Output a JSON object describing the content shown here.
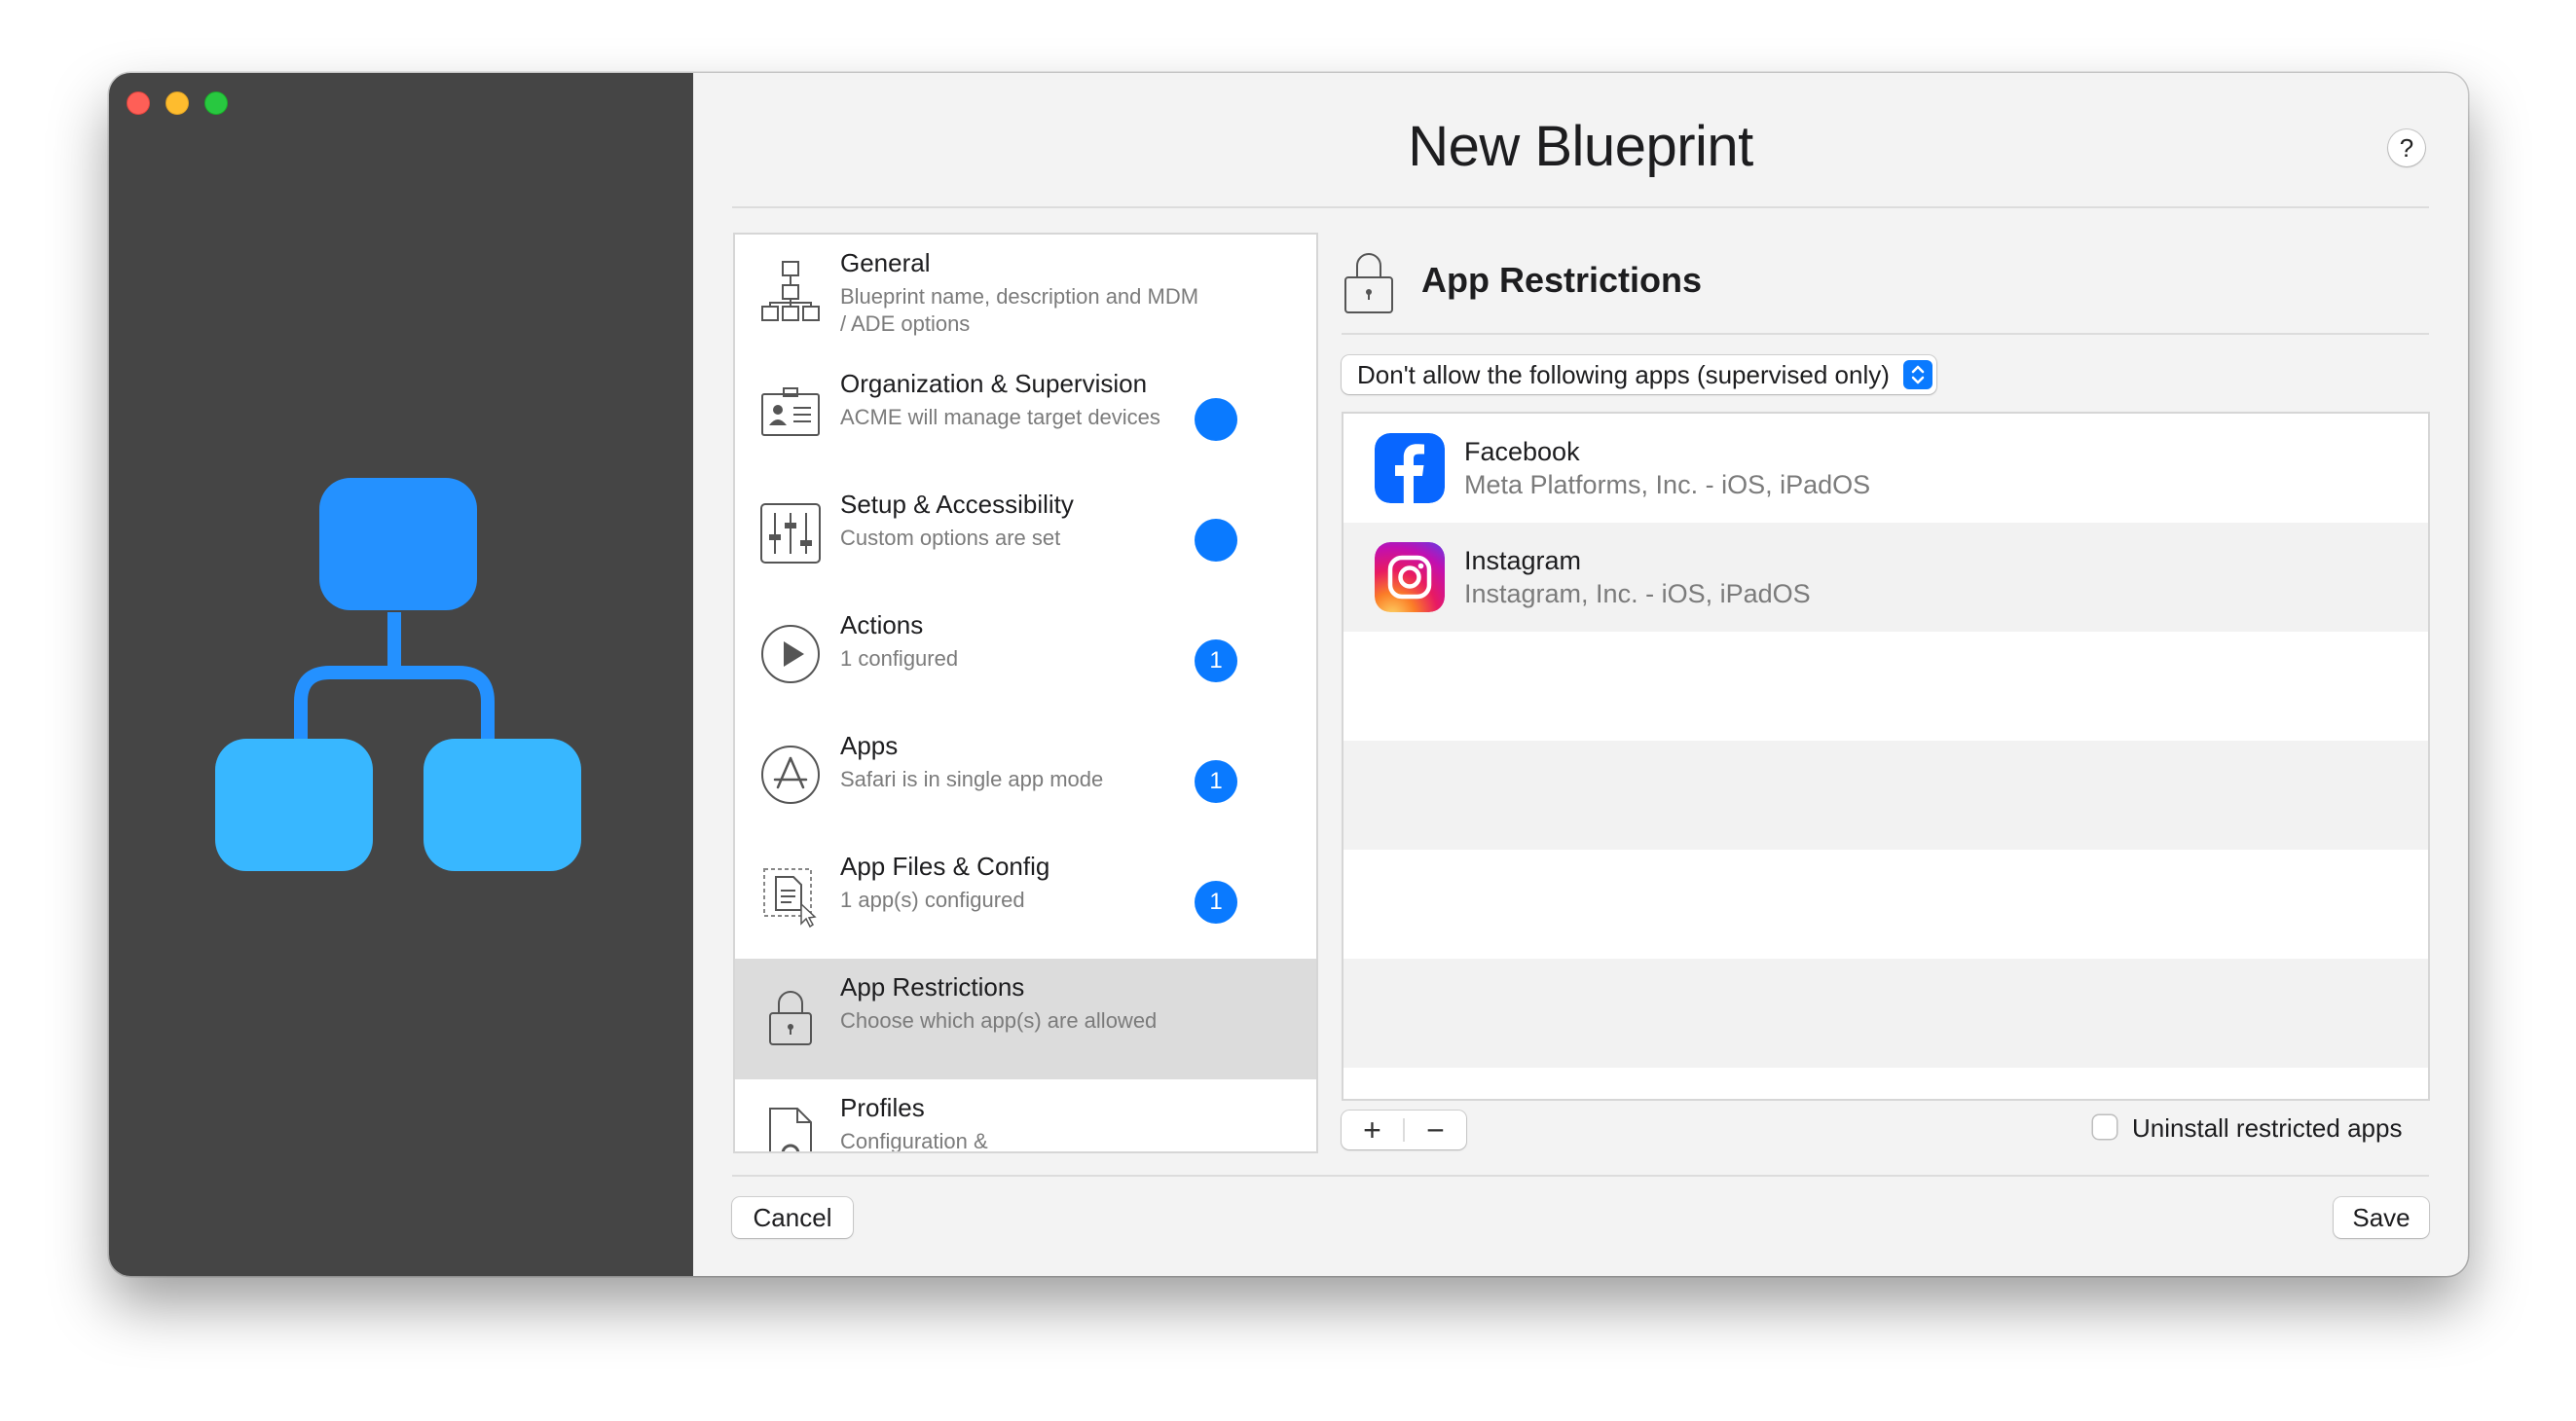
{
  "window": {
    "title": "New Blueprint",
    "help_label": "?"
  },
  "illustration": {
    "icon": "blueprint-hierarchy-icon",
    "colors": [
      "#2491ff",
      "#38b7ff"
    ]
  },
  "sections": [
    {
      "title": "General",
      "subtitle": "Blueprint name, description and MDM / ADE options",
      "icon": "hierarchy-icon",
      "badge": null,
      "selected": false
    },
    {
      "title": "Organization & Supervision",
      "subtitle": "ACME will manage target devices",
      "icon": "id-card-icon",
      "badge": "",
      "selected": false
    },
    {
      "title": "Setup & Accessibility",
      "subtitle": "Custom options are set",
      "icon": "sliders-icon",
      "badge": "",
      "selected": false
    },
    {
      "title": "Actions",
      "subtitle": "1 configured",
      "icon": "play-icon",
      "badge": "1",
      "selected": false
    },
    {
      "title": "Apps",
      "subtitle": "Safari is in single app mode",
      "icon": "app-store-icon",
      "badge": "1",
      "selected": false
    },
    {
      "title": "App Files & Config",
      "subtitle": "1 app(s) configured",
      "icon": "file-config-icon",
      "badge": "1",
      "selected": false
    },
    {
      "title": "App Restrictions",
      "subtitle": "Choose which app(s) are allowed",
      "icon": "lock-icon",
      "badge": null,
      "selected": true
    },
    {
      "title": "Profiles",
      "subtitle": "Configuration &",
      "icon": "profile-gear-icon",
      "badge": null,
      "selected": false
    }
  ],
  "detail": {
    "title": "App Restrictions",
    "mode_selected": "Don't allow the following apps (supervised only)",
    "apps": [
      {
        "name": "Facebook",
        "publisher": "Meta Platforms, Inc. - iOS, iPadOS",
        "icon": "facebook-icon"
      },
      {
        "name": "Instagram",
        "publisher": "Instagram, Inc. - iOS, iPadOS",
        "icon": "instagram-icon"
      }
    ],
    "add_label": "+",
    "remove_label": "−",
    "uninstall_label": "Uninstall restricted apps",
    "uninstall_checked": false
  },
  "footer": {
    "cancel_label": "Cancel",
    "save_label": "Save"
  },
  "colors": {
    "accent": "#0a7aff",
    "sidebar_bg": "#454545"
  }
}
